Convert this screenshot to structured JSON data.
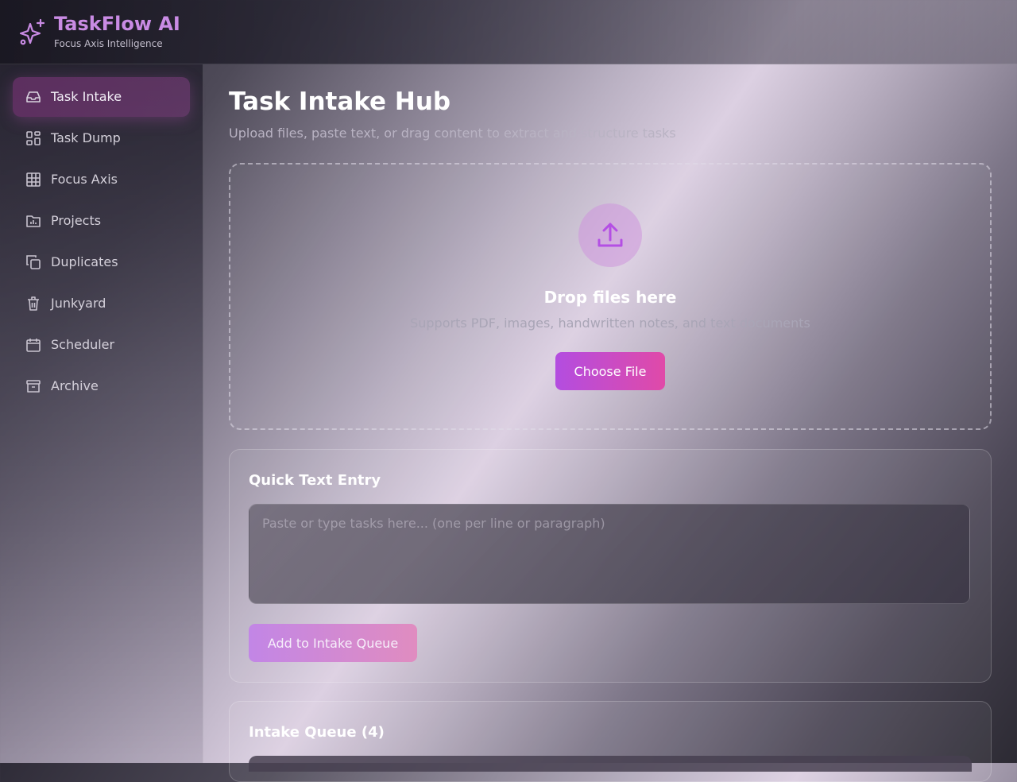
{
  "app": {
    "title": "TaskFlow AI",
    "subtitle": "Focus Axis Intelligence",
    "logo_icon": "sparkles-icon"
  },
  "sidebar": {
    "items": [
      {
        "label": "Task Intake",
        "icon": "inbox-icon",
        "active": true
      },
      {
        "label": "Task Dump",
        "icon": "grid-icon",
        "active": false
      },
      {
        "label": "Focus Axis",
        "icon": "table-icon",
        "active": false
      },
      {
        "label": "Projects",
        "icon": "folder-chart-icon",
        "active": false
      },
      {
        "label": "Duplicates",
        "icon": "copy-icon",
        "active": false
      },
      {
        "label": "Junkyard",
        "icon": "trash-icon",
        "active": false
      },
      {
        "label": "Scheduler",
        "icon": "calendar-icon",
        "active": false
      },
      {
        "label": "Archive",
        "icon": "archive-icon",
        "active": false
      }
    ]
  },
  "main": {
    "title": "Task Intake Hub",
    "subtitle": "Upload files, paste text, or drag content to extract and structure tasks",
    "dropzone": {
      "icon": "upload-icon",
      "title": "Drop files here",
      "subtitle": "Supports PDF, images, handwritten notes, and text documents",
      "button_label": "Choose File"
    },
    "quick_entry": {
      "title": "Quick Text Entry",
      "placeholder": "Paste or type tasks here... (one per line or paragraph)",
      "button_label": "Add to Intake Queue"
    },
    "queue": {
      "title": "Intake Queue (4)"
    }
  },
  "colors": {
    "brand": "#c98be4",
    "accent_start": "#b34de0",
    "accent_end": "#e04aa8"
  }
}
